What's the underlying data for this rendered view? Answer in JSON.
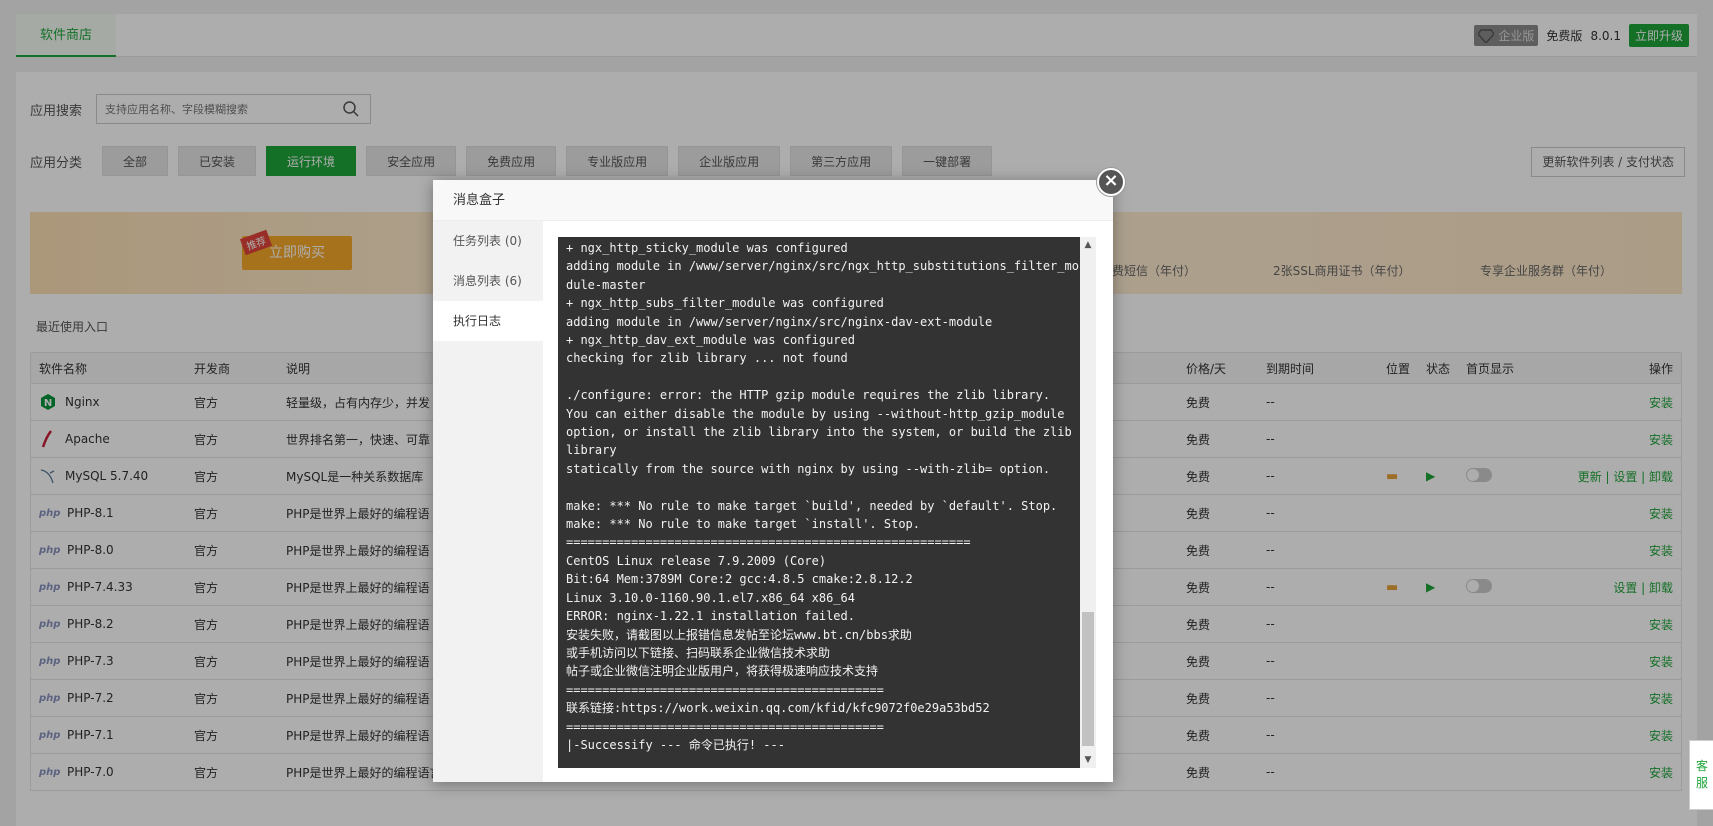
{
  "topbar": {
    "store_tab": "软件商店",
    "enterprise": "企业版",
    "free": "免费版",
    "version": "8.0.1",
    "upgrade": "立即升级"
  },
  "search": {
    "label": "应用搜索",
    "placeholder": "支持应用名称、字段模糊搜索"
  },
  "categories": {
    "label": "应用分类",
    "items": [
      "全部",
      "已安装",
      "运行环境",
      "安全应用",
      "免费应用",
      "专业版应用",
      "企业版应用",
      "第三方应用",
      "一键部署"
    ],
    "active_index": 2
  },
  "update_button": "更新软件列表 / 支付状态",
  "promo": {
    "tag": "推荐",
    "buy": "立即购买",
    "features": [
      "免费短信（年付）",
      "2张SSL商用证书（年付）",
      "专享企业服务群（年付）"
    ]
  },
  "recent_label": "最近使用入口",
  "table": {
    "headers": {
      "name": "软件名称",
      "dev": "开发商",
      "desc": "说明",
      "price": "价格/天",
      "expire": "到期时间",
      "pos": "位置",
      "state": "状态",
      "home": "首页显示",
      "op": "操作"
    },
    "rows": [
      {
        "name": "Nginx",
        "dev": "官方",
        "desc": "轻量级，占有内存少，并发",
        "price": "免费",
        "expire": "--",
        "op": "安装",
        "icon": "nginx-icon"
      },
      {
        "name": "Apache",
        "dev": "官方",
        "desc": "世界排名第一，快速、可靠",
        "price": "免费",
        "expire": "--",
        "op": "安装",
        "icon": "apache-icon"
      },
      {
        "name": "MySQL 5.7.40",
        "dev": "官方",
        "desc": "MySQL是一种关系数据库",
        "price": "免费",
        "expire": "--",
        "op": "更新 | 设置 | 卸载",
        "icon": "mysql-icon",
        "installed": true
      },
      {
        "name": "PHP-8.1",
        "dev": "官方",
        "desc": "PHP是世界上最好的编程语",
        "price": "免费",
        "expire": "--",
        "op": "安装",
        "icon": "php-icon"
      },
      {
        "name": "PHP-8.0",
        "dev": "官方",
        "desc": "PHP是世界上最好的编程语",
        "price": "免费",
        "expire": "--",
        "op": "安装",
        "icon": "php-icon"
      },
      {
        "name": "PHP-7.4.33",
        "dev": "官方",
        "desc": "PHP是世界上最好的编程语",
        "price": "免费",
        "expire": "--",
        "op": "设置 | 卸载",
        "icon": "php-icon",
        "installed": true
      },
      {
        "name": "PHP-8.2",
        "dev": "官方",
        "desc": "PHP是世界上最好的编程语",
        "price": "免费",
        "expire": "--",
        "op": "安装",
        "icon": "php-icon"
      },
      {
        "name": "PHP-7.3",
        "dev": "官方",
        "desc": "PHP是世界上最好的编程语",
        "price": "免费",
        "expire": "--",
        "op": "安装",
        "icon": "php-icon"
      },
      {
        "name": "PHP-7.2",
        "dev": "官方",
        "desc": "PHP是世界上最好的编程语",
        "price": "免费",
        "expire": "--",
        "op": "安装",
        "icon": "php-icon"
      },
      {
        "name": "PHP-7.1",
        "dev": "官方",
        "desc": "PHP是世界上最好的编程语",
        "price": "免费",
        "expire": "--",
        "op": "安装",
        "icon": "php-icon"
      },
      {
        "name": "PHP-7.0",
        "dev": "官方",
        "desc": "PHP是世界上最好的编程语言",
        "price": "免费",
        "expire": "--",
        "op": "安装",
        "icon": "php-icon"
      }
    ]
  },
  "modal": {
    "title": "消息盒子",
    "close": "×",
    "tabs": [
      "任务列表 (0)",
      "消息列表 (6)",
      "执行日志"
    ],
    "active_tab": 2,
    "log_lines": [
      "+ ngx_http_sticky_module was configured",
      "adding module in /www/server/nginx/src/ngx_http_substitutions_filter_module-master",
      "+ ngx_http_subs_filter_module was configured",
      "adding module in /www/server/nginx/src/nginx-dav-ext-module",
      "+ ngx_http_dav_ext_module was configured",
      "checking for zlib library ... not found",
      "",
      "./configure: error: the HTTP gzip module requires the zlib library.",
      "You can either disable the module by using --without-http_gzip_module",
      "option, or install the zlib library into the system, or build the zlib library",
      "statically from the source with nginx by using --with-zlib= option.",
      "",
      "make: *** No rule to make target `build', needed by `default'. Stop.",
      "make: *** No rule to make target `install'. Stop.",
      "========================================================",
      "CentOS Linux release 7.9.2009 (Core)",
      "Bit:64 Mem:3789M Core:2 gcc:4.8.5 cmake:2.8.12.2",
      "Linux 3.10.0-1160.90.1.el7.x86_64 x86_64",
      "ERROR: nginx-1.22.1 installation failed.",
      "安装失败，请截图以上报错信息发帖至论坛www.bt.cn/bbs求助",
      "或手机访问以下链接、扫码联系企业微信技术求助",
      "帖子或企业微信注明企业版用户，将获得极速响应技术支持",
      "============================================",
      "联系链接:https://work.weixin.qq.com/kfid/kfc9072f0e29a53bd52",
      "============================================",
      "|-Successify --- 命令已执行! ---"
    ]
  },
  "float_service": "客服"
}
